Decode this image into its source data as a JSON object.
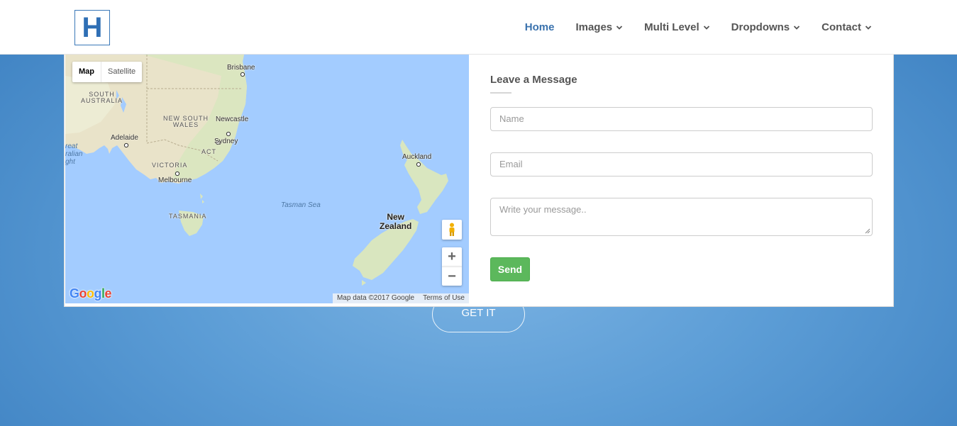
{
  "brand": {
    "logo_letter": "H"
  },
  "nav": {
    "items": [
      {
        "label": "Home",
        "active": true,
        "has_dropdown": false
      },
      {
        "label": "Images",
        "active": false,
        "has_dropdown": true
      },
      {
        "label": "Multi Level",
        "active": false,
        "has_dropdown": true
      },
      {
        "label": "Dropdowns",
        "active": false,
        "has_dropdown": true
      },
      {
        "label": "Contact",
        "active": false,
        "has_dropdown": true
      }
    ]
  },
  "map": {
    "type_buttons": {
      "map": "Map",
      "satellite": "Satellite"
    },
    "labels": {
      "brisbane": "Brisbane",
      "south_australia_1": "SOUTH",
      "south_australia_2": "AUSTRALIA",
      "nsw_1": "NEW SOUTH",
      "nsw_2": "WALES",
      "newcastle": "Newcastle",
      "sydney": "Sydney",
      "adelaide": "Adelaide",
      "act": "ACT",
      "victoria": "VICTORIA",
      "melbourne": "Melbourne",
      "tasmania": "TASMANIA",
      "tasman_sea": "Tasman Sea",
      "auckland": "Auckland",
      "nz_1": "New",
      "nz_2": "Zealand",
      "bight_1": "reat",
      "bight_2": "ralian",
      "bight_3": "ght"
    },
    "zoom_in": "+",
    "zoom_out": "−",
    "google_logo": "Google",
    "attribution": {
      "data": "Map data ©2017 Google",
      "terms": "Terms of Use"
    }
  },
  "form": {
    "title": "Leave a Message",
    "name_placeholder": "Name",
    "email_placeholder": "Email",
    "message_placeholder": "Write your message..",
    "send_label": "Send"
  },
  "cta": {
    "label": "GET IT"
  },
  "colors": {
    "accent": "#3a72ad",
    "send": "#5cb85c",
    "background_blue": "#5c9dd6",
    "sea": "#a3ccff"
  }
}
